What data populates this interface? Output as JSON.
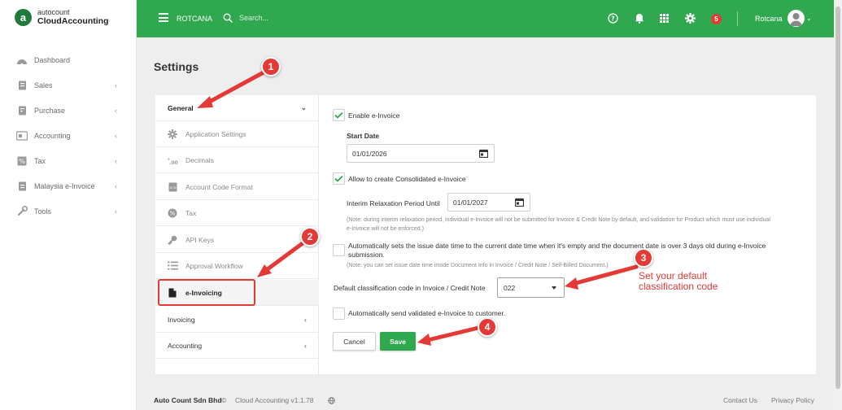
{
  "app": {
    "logo_top": "autocount",
    "logo_bottom": "CloudAccounting",
    "logo_mark": "a"
  },
  "sidebar": {
    "items": [
      {
        "label": "Dashboard",
        "icon": "dashboard-icon",
        "has_chevron": false
      },
      {
        "label": "Sales",
        "icon": "sales-icon",
        "has_chevron": true
      },
      {
        "label": "Purchase",
        "icon": "purchase-icon",
        "has_chevron": true
      },
      {
        "label": "Accounting",
        "icon": "accounting-icon",
        "has_chevron": true
      },
      {
        "label": "Tax",
        "icon": "tax-icon",
        "has_chevron": true
      },
      {
        "label": "Malaysia e-Invoice",
        "icon": "einvoice-icon",
        "has_chevron": true
      },
      {
        "label": "Tools",
        "icon": "tools-icon",
        "has_chevron": true
      }
    ],
    "chevron": "‹"
  },
  "topbar": {
    "company": "ROTCANA",
    "search_placeholder": "Search...",
    "notification_count": "5",
    "user": "Rotcana",
    "color": "#2fa84f"
  },
  "page": {
    "title": "Settings"
  },
  "settings_nav": {
    "general_header": "General",
    "general_chevron": "⌄",
    "sub_items": [
      {
        "label": "Application Settings",
        "icon": "gear-icon"
      },
      {
        "label": "Decimals",
        "icon": "decimals-icon"
      },
      {
        "label": "Account Code Format",
        "icon": "code-icon"
      },
      {
        "label": "Tax",
        "icon": "percent-icon"
      },
      {
        "label": "API Keys",
        "icon": "key-icon"
      },
      {
        "label": "Approval Workflow",
        "icon": "checklist-icon"
      },
      {
        "label": "e-Invoicing",
        "icon": "document-icon"
      }
    ],
    "groups": [
      {
        "label": "Invoicing"
      },
      {
        "label": "Accounting"
      }
    ],
    "group_chevron": "‹"
  },
  "form": {
    "enable_einvoice": {
      "label": "Enable e-Invoice",
      "checked": true
    },
    "start_date": {
      "label": "Start Date",
      "value": "01/01/2026"
    },
    "allow_consolidated": {
      "label": "Allow to create Consolidated e-Invoice",
      "checked": true
    },
    "interim": {
      "label": "Interim Relaxation Period Until",
      "value": "01/01/2027"
    },
    "interim_note_1": "(Note: during interim relaxation period, individual e-Invoice will not be submitted for Invoice & Credit Note by default, and validation for Product which must use individual",
    "interim_note_2": "e-Invoice will not be enforced.)",
    "auto_issue": {
      "label_1": "Automatically sets the issue date time to the current date time when it's empty and the document date is over 3 days old during e-Invoice",
      "label_2": "submission.",
      "checked": false
    },
    "auto_issue_note": "(Note: you can set issue date time inside Document Info in Invoice / Credit Note / Self-Billed Document.)",
    "classification": {
      "label": "Default classification code in Invoice / Credit Note",
      "value": "022"
    },
    "auto_send": {
      "label": "Automatically send validated e-Invoice to customer.",
      "checked": false
    },
    "cancel_label": "Cancel",
    "save_label": "Save"
  },
  "footer": {
    "company": "Auto Count Sdn Bhd",
    "copyright": "©",
    "product": "Cloud Accounting v1.1.78",
    "contact": "Contact Us",
    "privacy": "Privacy Policy"
  },
  "annotations": {
    "step1": "1",
    "step2": "2",
    "step3": "3",
    "step4": "4",
    "callout_line1": "Set your default",
    "callout_line2": "classification code",
    "color": "#e53935"
  }
}
